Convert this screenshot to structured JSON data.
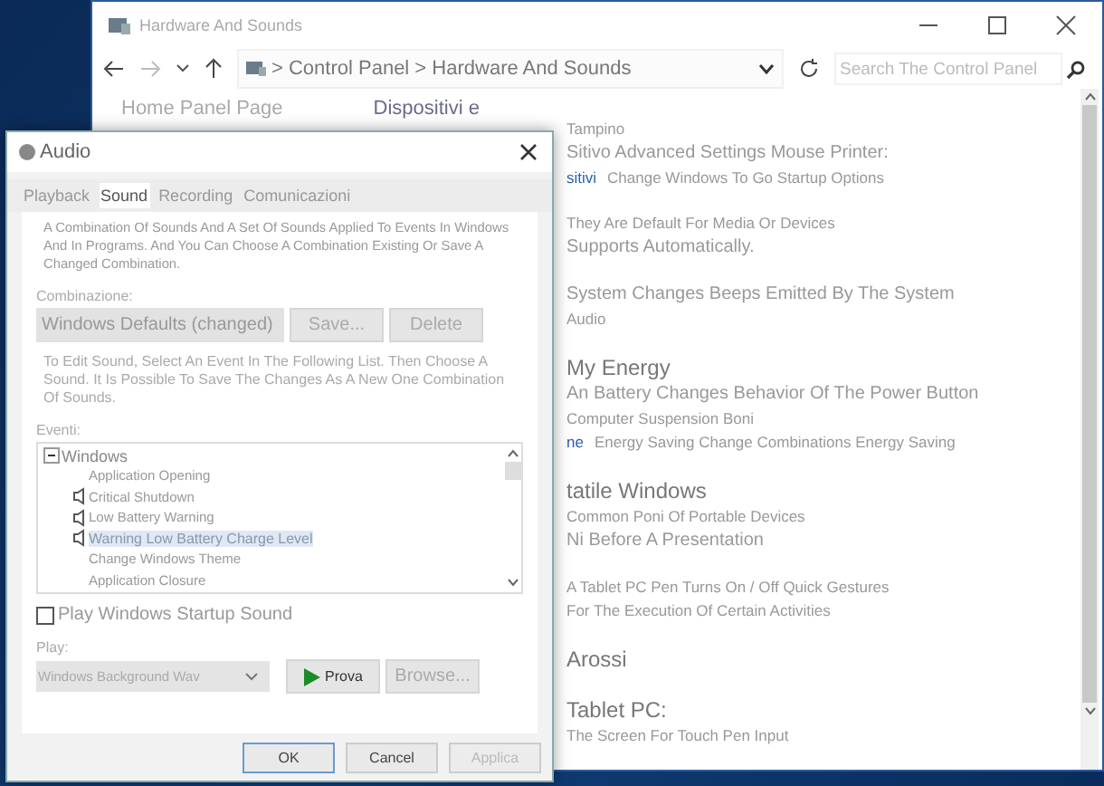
{
  "window": {
    "title": "Hardware And Sounds"
  },
  "address_bar": {
    "path": "> Control Panel > Hardware And Sounds",
    "search_placeholder": "Search The Control Panel"
  },
  "nav": {
    "home_link": "Home Panel Page",
    "heading": "Dispositivi e"
  },
  "groups": [
    {
      "lines": [
        {
          "kind": "small",
          "text": "Tampino"
        },
        {
          "kind": "text",
          "text": "Sitivo Advanced Settings Mouse Printer:"
        },
        {
          "kind": "small",
          "prefix": "sitivi",
          "text": "Change Windows To Go Startup Options"
        }
      ]
    },
    {
      "lines": [
        {
          "kind": "small",
          "text": "They Are Default For Media Or Devices"
        },
        {
          "kind": "text",
          "text": "Supports Automatically."
        }
      ]
    },
    {
      "lines": [
        {
          "kind": "text",
          "text": "System Changes Beeps Emitted By The System"
        },
        {
          "kind": "small",
          "text": "Audio"
        }
      ]
    },
    {
      "lines": [
        {
          "kind": "heading",
          "text": "My Energy"
        },
        {
          "kind": "text",
          "text": "An Battery Changes Behavior Of The Power Button"
        },
        {
          "kind": "small",
          "text": "Computer Suspension Boni"
        },
        {
          "kind": "small",
          "prefix": "ne",
          "text": "Energy Saving Change Combinations Energy Saving"
        }
      ]
    },
    {
      "lines": [
        {
          "kind": "heading",
          "text": "tatile Windows"
        },
        {
          "kind": "small",
          "text": "Common Poni Of Portable Devices"
        },
        {
          "kind": "text",
          "text": "Ni Before A Presentation"
        }
      ]
    },
    {
      "lines": [
        {
          "kind": "small",
          "text": "A Tablet PC Pen Turns On / Off Quick Gestures"
        },
        {
          "kind": "small",
          "text": "For The Execution Of Certain Activities"
        }
      ]
    },
    {
      "lines": [
        {
          "kind": "heading",
          "text": "Arossi"
        }
      ]
    },
    {
      "lines": [
        {
          "kind": "heading",
          "text": "Tablet PC:"
        },
        {
          "kind": "small",
          "text": "The Screen For Touch Pen Input"
        }
      ]
    }
  ],
  "dialog": {
    "title": "Audio",
    "tabs": [
      {
        "label": "Playback",
        "selected": false
      },
      {
        "label": "Sound",
        "selected": true
      },
      {
        "label": "Recording",
        "selected": false
      },
      {
        "label": "Comunicazioni",
        "selected": false
      }
    ],
    "description": "A Combination Of Sounds And A Set Of Sounds Applied To Events In Windows And In Programs. And You Can Choose A Combination Existing Or Save A Changed Combination.",
    "scheme_label": "Combinazione:",
    "scheme_value": "Windows Defaults (changed)",
    "save_button": "Save...",
    "delete_button": "Delete",
    "instructions": "To Edit Sound, Select An Event In The Following List. Then Choose A Sound. It Is Possible To Save The Changes As A New One Combination Of Sounds.",
    "events_label": "Eventi:",
    "events": [
      {
        "label": "Windows",
        "expanded": true,
        "children": [
          {
            "label": "Application Opening",
            "sound": false,
            "selected": false
          },
          {
            "label": "Critical Shutdown",
            "sound": true,
            "selected": false
          },
          {
            "label": "Low Battery Warning",
            "sound": true,
            "selected": false
          },
          {
            "label": "Warning Low Battery Charge Level",
            "sound": true,
            "selected": true
          },
          {
            "label": "Change Windows Theme",
            "sound": false,
            "selected": false
          },
          {
            "label": "Application Closure",
            "sound": false,
            "selected": false
          }
        ]
      }
    ],
    "startup_sound": {
      "label": "Play Windows Startup Sound",
      "checked": false
    },
    "play_label": "Play:",
    "sound_value": "Windows Background Wav",
    "test_button": "Prova",
    "browse_button": "Browse...",
    "buttons": [
      {
        "label": "OK",
        "kind": "default",
        "disabled": false
      },
      {
        "label": "Cancel",
        "kind": "normal",
        "disabled": false
      },
      {
        "label": "Applica",
        "kind": "normal",
        "disabled": true
      }
    ]
  }
}
